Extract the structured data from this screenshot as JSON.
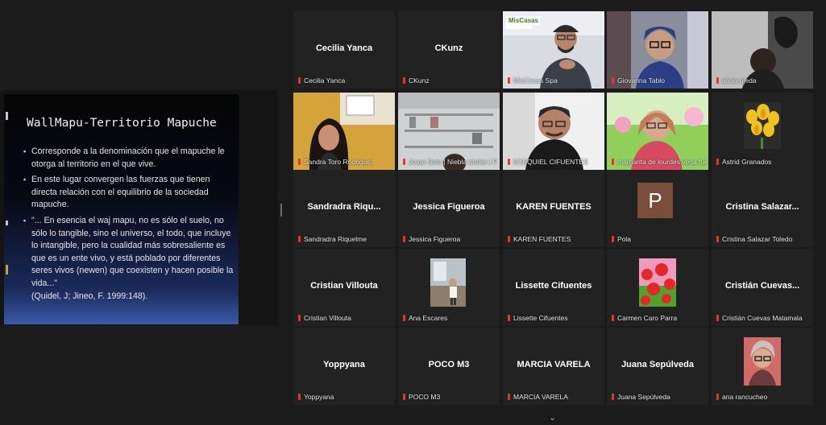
{
  "slide": {
    "title": "WallMapu-Territorio Mapuche",
    "bullets": [
      "Corresponde a la denominación que el mapuche le otorga al territorio en el que vive.",
      "En este lugar convergen las fuerzas que tienen directa relación con el equilibrio de la sociedad mapuche.",
      "\"... En esencia el waj mapu, no es sólo el suelo, no sólo lo tangible, sino el universo, el todo, que incluye lo intangible, pero la cualidad más sobresaliente es que es un ente vivo, y está poblado por diferentes seres vivos (newen) que coexisten y hacen posible la vida...\""
    ],
    "citation": "(Quidel, J; Jineo, F. 1999:148)."
  },
  "participants": [
    {
      "display_name": "Cecilia Yanca",
      "label": "Cecilia Yanca"
    },
    {
      "display_name": "CKunz",
      "label": "CKunz"
    },
    {
      "display_name": "",
      "label": "MisCasas Spa",
      "video": "man-glasses",
      "active": true,
      "logo_text": "MisCasas"
    },
    {
      "display_name": "",
      "label": "Giovanna Tablo",
      "video": "woman-glasses"
    },
    {
      "display_name": "",
      "label": "alicia ojeda",
      "video": "dark-room"
    },
    {
      "display_name": "",
      "label": "Sandra Toro Rodriguez",
      "video": "woman-dark-hair"
    },
    {
      "display_name": "",
      "label": "Jorge Soto | Niebla atelier | P. C...",
      "video": "kitchen"
    },
    {
      "display_name": "",
      "label": "EXEQUIEL CIFUENTES",
      "video": "older-man"
    },
    {
      "display_name": "",
      "label": "margarita de lourdes vega fuen...",
      "video": "woman-flowers"
    },
    {
      "display_name": "",
      "label": "Astrid Granados",
      "avatar": "tulips"
    },
    {
      "display_name": "Sandradra Riqu...",
      "label": "Sandradra Riquelme"
    },
    {
      "display_name": "Jessica Figueroa",
      "label": "Jessica Figueroa"
    },
    {
      "display_name": "KAREN FUENTES",
      "label": "KAREN FUENTES"
    },
    {
      "display_name": "",
      "label": "Pola",
      "initial": "P"
    },
    {
      "display_name": "Cristina Salazar...",
      "label": "Cristina Salazar Toledo"
    },
    {
      "display_name": "Cristian Villouta",
      "label": "Cristian Villouta"
    },
    {
      "display_name": "",
      "label": "Ana Escares",
      "avatar": "person-photo"
    },
    {
      "display_name": "Lissette Cifuentes",
      "label": "Lissette Cifuentes"
    },
    {
      "display_name": "",
      "label": "Carmen Caro Parra",
      "avatar": "red-flowers"
    },
    {
      "display_name": "Cristián Cuevas...",
      "label": "Cristián Cuevas Matamala"
    },
    {
      "display_name": "Yoppyana",
      "label": "Yoppyana"
    },
    {
      "display_name": "POCO M3",
      "label": "POCO M3"
    },
    {
      "display_name": "MARCIA VARELA",
      "label": "MARCIA VARELA"
    },
    {
      "display_name": "Juana Sepúlveda",
      "label": "Juana Sepúlveda"
    },
    {
      "display_name": "",
      "label": "ana rancucheo",
      "avatar": "woman-glasses-photo"
    }
  ],
  "icons": {
    "muted_mic": "muted-mic-icon",
    "scroll": "chevron-down-icon"
  },
  "colors": {
    "background": "#1b1b1b",
    "tile": "#222222",
    "active_speaker": "#c6d95a",
    "muted": "#e8352b"
  }
}
